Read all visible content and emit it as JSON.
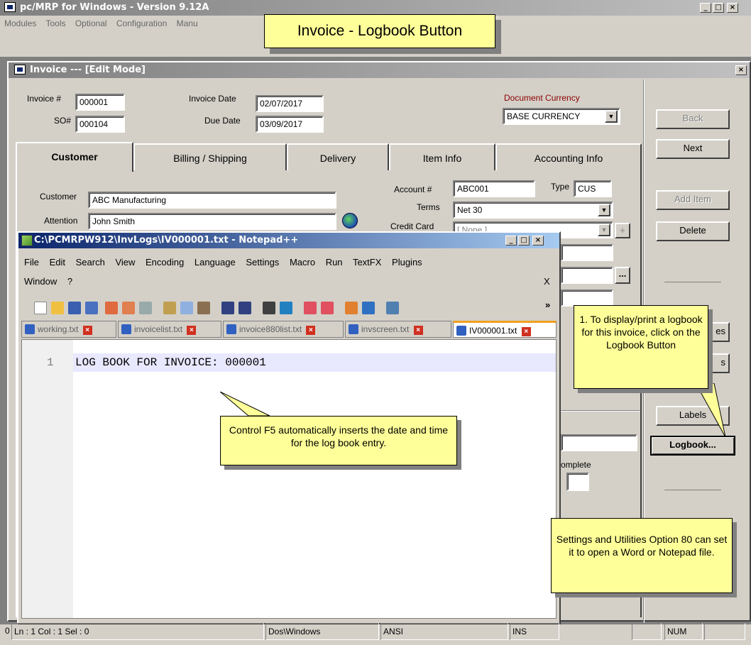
{
  "app": {
    "title": "pc/MRP for Windows - Version 9.12A",
    "menu": [
      "Modules",
      "Tools",
      "Optional",
      "Configuration",
      "Manu"
    ]
  },
  "banner": "Invoice - Logbook Button",
  "invoice": {
    "title": "Invoice --- [Edit Mode]",
    "invoice_no_label": "Invoice #",
    "invoice_no": "000001",
    "so_label": "SO#",
    "so_no": "000104",
    "invoice_date_label": "Invoice Date",
    "invoice_date": "02/07/2017",
    "due_date_label": "Due Date",
    "due_date": "03/09/2017",
    "currency_label": "Document Currency",
    "currency": "BASE CURRENCY",
    "tabs": [
      "Customer",
      "Billing / Shipping",
      "Delivery",
      "Item Info",
      "Accounting Info"
    ],
    "customer_label": "Customer",
    "customer": "ABC Manufacturing",
    "attention_label": "Attention",
    "attention": "John Smith",
    "account_label": "Account #",
    "account": "ABC001",
    "type_label": "Type",
    "type": "CUS",
    "terms_label": "Terms",
    "terms": "Net 30",
    "credit_label": "Credit Card",
    "credit_value": "[ None ]",
    "complete_label": "omplete",
    "buttons": {
      "back": "Back",
      "next": "Next",
      "add_item": "Add Item",
      "delete": "Delete",
      "labels": "Labels",
      "logbook": "Logbook...",
      "hidden1": "es",
      "hidden2": "s"
    },
    "status_num": "NUM",
    "status_left": "0"
  },
  "notepad": {
    "title": "C:\\PCMRPW912\\InvLogs\\IV000001.txt - Notepad++",
    "menu": [
      "File",
      "Edit",
      "Search",
      "View",
      "Encoding",
      "Language",
      "Settings",
      "Macro",
      "Run",
      "TextFX",
      "Plugins"
    ],
    "menu2": [
      "Window",
      "?"
    ],
    "menu_close": "X",
    "tabs": [
      "working.txt",
      "invoicelist.txt",
      "invoice880list.txt",
      "invscreen.txt",
      "IV000001.txt"
    ],
    "line_no": "1",
    "line_text": "LOG BOOK FOR INVOICE: 000001",
    "status": {
      "pos": "Ln : 1    Col : 1    Sel : 0",
      "eol": "Dos\\Windows",
      "enc": "ANSI",
      "mode": "INS"
    }
  },
  "callouts": {
    "logbook": "1. To display/print a logbook for this invoice, click on the Logbook Button",
    "ctrl_f5": "Control F5 automatically inserts the date and time for the log book entry.",
    "settings": "Settings and Utilities Option 80 can set it to open a Word or Notepad file."
  }
}
